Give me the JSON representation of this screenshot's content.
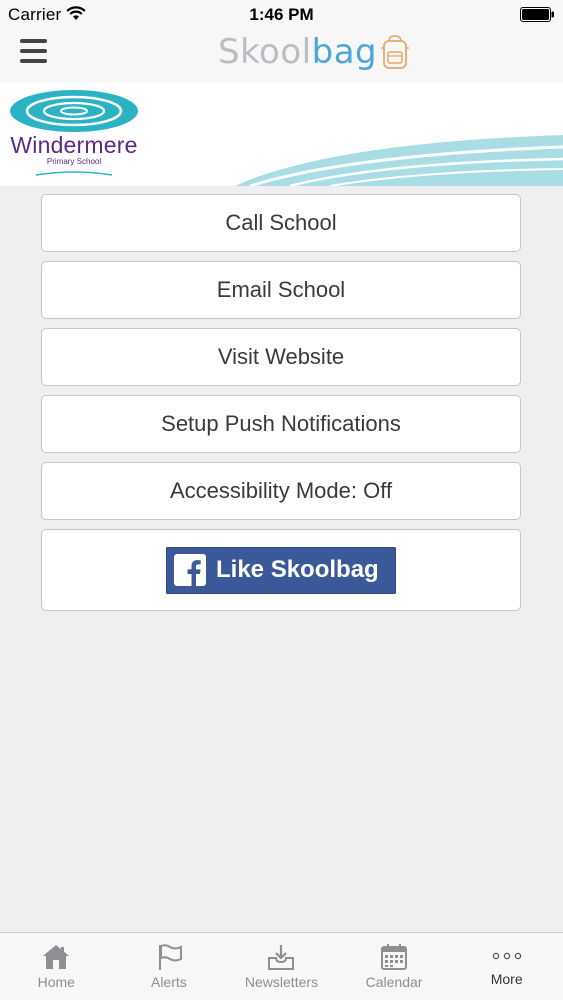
{
  "status_bar": {
    "carrier": "Carrier",
    "time": "1:46 PM"
  },
  "nav": {
    "brand_part1": "Skool",
    "brand_part2": "bag",
    "menu_icon": "hamburger-menu-icon"
  },
  "banner": {
    "school_name": "Windermere",
    "school_subtitle": "Primary School"
  },
  "actions": {
    "call": "Call School",
    "email": "Email School",
    "website": "Visit Website",
    "push": "Setup Push Notifications",
    "accessibility": "Accessibility Mode: Off",
    "facebook": "Like Skoolbag"
  },
  "tabs": [
    {
      "label": "Home",
      "icon": "home-icon"
    },
    {
      "label": "Alerts",
      "icon": "flag-icon"
    },
    {
      "label": "Newsletters",
      "icon": "inbox-download-icon"
    },
    {
      "label": "Calendar",
      "icon": "calendar-icon"
    },
    {
      "label": "More",
      "icon": "more-dots-icon"
    }
  ],
  "colors": {
    "brand_grey": "#b9bcc0",
    "brand_blue": "#4da6d8",
    "school_purple": "#5b2a86",
    "logo_teal": "#2bb3c4",
    "facebook_blue": "#3b5998"
  }
}
